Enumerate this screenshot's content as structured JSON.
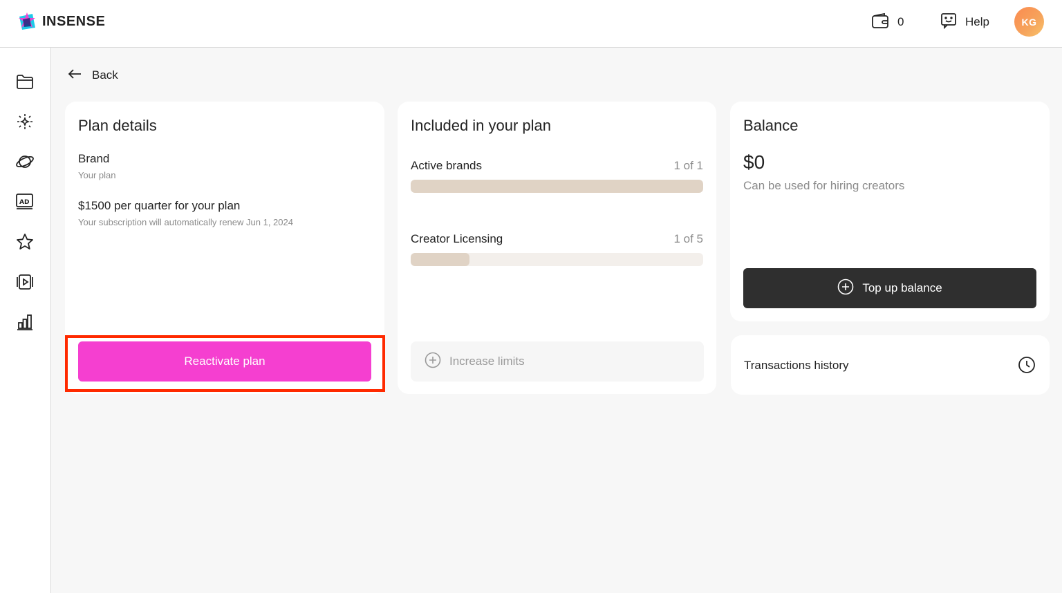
{
  "brand": {
    "name": "INSENSE"
  },
  "header": {
    "wallet_count": "0",
    "help_label": "Help",
    "avatar_initials": "KG",
    "avatar_color": "#fb8a4f"
  },
  "sidebar": {
    "items": [
      {
        "icon": "folder-icon"
      },
      {
        "icon": "sparkle-sun-icon"
      },
      {
        "icon": "planet-icon"
      },
      {
        "icon": "ad-icon"
      },
      {
        "icon": "star-icon"
      },
      {
        "icon": "video-play-icon"
      },
      {
        "icon": "bar-chart-icon"
      }
    ]
  },
  "back": {
    "label": "Back"
  },
  "plan_details": {
    "title": "Plan details",
    "plan_name": "Brand",
    "plan_name_caption": "Your plan",
    "price": "$1500 per quarter for your plan",
    "renewal_note": "Your subscription will automatically renew Jun 1, 2024",
    "reactivate_label": "Reactivate plan",
    "accent_color": "#f53fd0",
    "highlight_color": "#ff2a00"
  },
  "included": {
    "title": "Included in your plan",
    "limits": [
      {
        "label": "Active brands",
        "count": "1 of 1",
        "used": 1,
        "total": 1
      },
      {
        "label": "Creator Licensing",
        "count": "1 of 5",
        "used": 1,
        "total": 5
      }
    ],
    "increase_label": "Increase limits"
  },
  "balance": {
    "title": "Balance",
    "amount": "$0",
    "note": "Can be used for hiring creators",
    "topup_label": "Top up balance"
  },
  "transactions": {
    "label": "Transactions history"
  }
}
